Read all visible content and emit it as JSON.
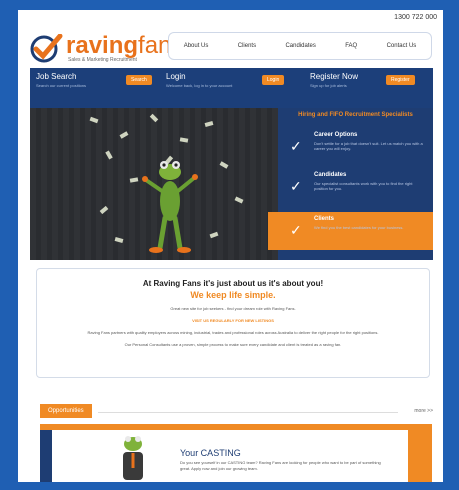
{
  "header": {
    "phone": "1300 722 000",
    "logo_word_raving": "raving",
    "logo_word_fans": "fans",
    "logo_tagline": "Sales & Marketing Recruitment"
  },
  "nav": {
    "items": [
      "About Us",
      "Clients",
      "Candidates",
      "FAQ",
      "Contact Us"
    ]
  },
  "loginbar": {
    "job_search_title": "Job Search",
    "job_search_sub": "Search our current positions",
    "job_search_btn": "Search",
    "login_title": "Login",
    "login_sub": "Welcome back, log in to your account",
    "login_btn": "Login",
    "register_title": "Register Now",
    "register_sub": "Sign up for job alerts",
    "register_btn": "Register"
  },
  "panel": {
    "heading": "Hiring and FIFO Recruitment Specialists",
    "items": [
      {
        "title": "Career Options",
        "desc": "Don't settle for a job that doesn't suit. Let us match you with a career you will enjoy."
      },
      {
        "title": "Candidates",
        "desc": "Our specialist consultants work with you to find the right position for you."
      },
      {
        "title": "Clients",
        "desc": "We find you the best candidates for your business."
      }
    ]
  },
  "intro": {
    "heading": "At Raving Fans it's just about us it's about you!",
    "subheading": "We keep life simple.",
    "line1": "Great new site for job seekers - find your dream role with Raving Fans.",
    "highlight": "VISIT US REGULARLY FOR NEW LISTINGS",
    "line2": "Raving Fans partners with quality employers across mining, industrial, trades and professional roles across Australia to deliver the right people for the right positions.",
    "line3": "Our Personal Consultants use a proven, simple process to make sure every candidate and client is treated as a raving fan."
  },
  "opportunities": {
    "tab_label": "Opportunities",
    "more_label": "more >>",
    "job_title": "Your CASTING",
    "job_desc": "Do you see yourself in our CASTING team? Raving Fans are looking for people who want to be part of something great. Apply now and join our growing team."
  },
  "colors": {
    "accent": "#f08a24",
    "navy": "#1e3d73",
    "frame": "#1f5fb3"
  }
}
